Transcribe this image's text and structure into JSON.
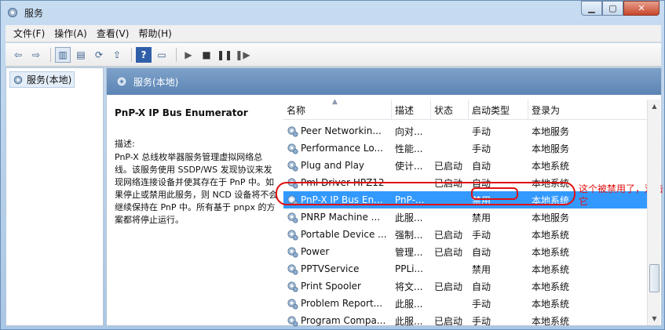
{
  "window": {
    "title": "服务"
  },
  "menubar": {
    "items": [
      "文件(F)",
      "操作(A)",
      "查看(V)",
      "帮助(H)"
    ]
  },
  "toolbar": {
    "icons": [
      "back-arrow-icon",
      "forward-arrow-icon",
      "show-tree-icon",
      "properties-icon",
      "refresh-icon",
      "export-icon",
      "help-icon",
      "console-icon",
      "play-icon",
      "stop-icon",
      "pause-icon",
      "restart-icon"
    ]
  },
  "tree": {
    "root": "服务(本地)"
  },
  "pane": {
    "header": "服务(本地)"
  },
  "description": {
    "title": "PnP-X IP Bus Enumerator",
    "label": "描述:",
    "body": "PnP-X 总线枚举器服务管理虚拟网络总线。该服务使用 SSDP/WS 发现协议来发现网络连接设备并使其存在于 PnP 中。如果停止或禁用此服务，则 NCD 设备将不会继续保持在 PnP 中。所有基于 pnpx 的方案都将停止运行。"
  },
  "columns": {
    "name": "名称",
    "desc": "描述",
    "status": "状态",
    "startup": "启动类型",
    "logon": "登录为"
  },
  "services": [
    {
      "name": "Peer Networkin...",
      "desc": "向对...",
      "status": "",
      "startup": "手动",
      "logon": "本地服务"
    },
    {
      "name": "Performance Lo...",
      "desc": "性能...",
      "status": "",
      "startup": "手动",
      "logon": "本地服务"
    },
    {
      "name": "Plug and Play",
      "desc": "使计...",
      "status": "已启动",
      "startup": "自动",
      "logon": "本地系统"
    },
    {
      "name": "Pml Driver HPZ12",
      "desc": "",
      "status": "已启动",
      "startup": "自动",
      "logon": "本地系统"
    },
    {
      "name": "PnP-X IP Bus En...",
      "desc": "PnP-...",
      "status": "",
      "startup": "禁用",
      "logon": "本地系统",
      "selected": true
    },
    {
      "name": "PNRP Machine ...",
      "desc": "此服...",
      "status": "",
      "startup": "禁用",
      "logon": "本地服务"
    },
    {
      "name": "Portable Device ...",
      "desc": "强制...",
      "status": "已启动",
      "startup": "手动",
      "logon": "本地系统"
    },
    {
      "name": "Power",
      "desc": "管理...",
      "status": "已启动",
      "startup": "自动",
      "logon": "本地系统"
    },
    {
      "name": "PPTVService",
      "desc": "PPLi...",
      "status": "",
      "startup": "禁用",
      "logon": "本地系统"
    },
    {
      "name": "Print Spooler",
      "desc": "将文...",
      "status": "已启动",
      "startup": "自动",
      "logon": "本地系统"
    },
    {
      "name": "Problem Report...",
      "desc": "此服...",
      "status": "",
      "startup": "手动",
      "logon": "本地系统"
    },
    {
      "name": "Program Compa...",
      "desc": "此服...",
      "status": "已启动",
      "startup": "手动",
      "logon": "本地系统"
    }
  ],
  "annotation": {
    "text": "这个被禁用了，双击它"
  },
  "colors": {
    "selection": "#3399ff",
    "annotation": "#e01010",
    "header": "#5b84b4"
  }
}
